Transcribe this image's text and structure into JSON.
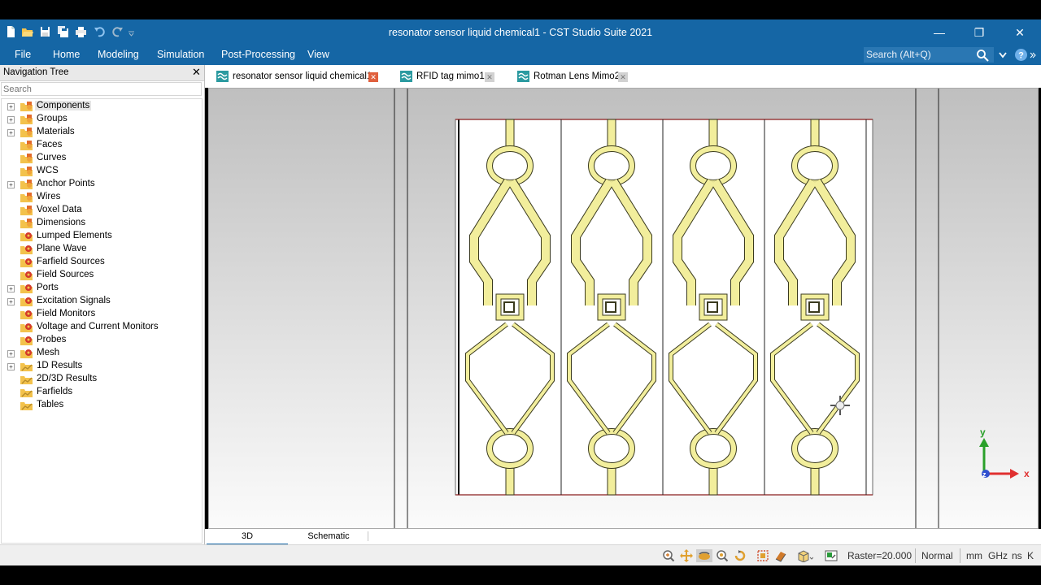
{
  "window": {
    "title": "resonator sensor liquid chemical1 - CST Studio Suite 2021",
    "minimize_glyph": "—",
    "restore_glyph": "❐",
    "close_glyph": "✕"
  },
  "quick_access": [
    "new-file-icon",
    "open-folder-icon",
    "save-icon",
    "save-all-icon",
    "print-icon",
    "undo-icon",
    "redo-icon",
    "customize-icon"
  ],
  "menu": {
    "items": [
      "File",
      "Home",
      "Modeling",
      "Simulation",
      "Post-Processing",
      "View"
    ],
    "search_placeholder": "Search (Alt+Q)"
  },
  "nav": {
    "title": "Navigation Tree",
    "close_glyph": "✕",
    "search_placeholder": "Search",
    "items": [
      {
        "label": "Components",
        "expandable": true,
        "icon": "folder-shapes-icon"
      },
      {
        "label": "Groups",
        "expandable": true,
        "icon": "folder-shapes-icon"
      },
      {
        "label": "Materials",
        "expandable": true,
        "icon": "folder-shapes-icon"
      },
      {
        "label": "Faces",
        "expandable": false,
        "icon": "folder-shapes-icon"
      },
      {
        "label": "Curves",
        "expandable": false,
        "icon": "folder-shapes-icon"
      },
      {
        "label": "WCS",
        "expandable": false,
        "icon": "folder-shapes-icon"
      },
      {
        "label": "Anchor Points",
        "expandable": true,
        "icon": "folder-shapes-icon"
      },
      {
        "label": "Wires",
        "expandable": false,
        "icon": "folder-shapes-icon"
      },
      {
        "label": "Voxel Data",
        "expandable": false,
        "icon": "folder-shapes-icon"
      },
      {
        "label": "Dimensions",
        "expandable": false,
        "icon": "folder-shapes-icon"
      },
      {
        "label": "Lumped Elements",
        "expandable": false,
        "icon": "folder-gear-icon"
      },
      {
        "label": "Plane Wave",
        "expandable": false,
        "icon": "folder-gear-icon"
      },
      {
        "label": "Farfield Sources",
        "expandable": false,
        "icon": "folder-gear-icon"
      },
      {
        "label": "Field Sources",
        "expandable": false,
        "icon": "folder-gear-icon"
      },
      {
        "label": "Ports",
        "expandable": true,
        "icon": "folder-gear-icon"
      },
      {
        "label": "Excitation Signals",
        "expandable": true,
        "icon": "folder-gear-icon"
      },
      {
        "label": "Field Monitors",
        "expandable": false,
        "icon": "folder-gear-icon"
      },
      {
        "label": "Voltage and Current Monitors",
        "expandable": false,
        "icon": "folder-gear-icon"
      },
      {
        "label": "Probes",
        "expandable": false,
        "icon": "folder-gear-icon"
      },
      {
        "label": "Mesh",
        "expandable": true,
        "icon": "folder-gear-icon"
      },
      {
        "label": "1D Results",
        "expandable": true,
        "icon": "folder-results-icon"
      },
      {
        "label": "2D/3D Results",
        "expandable": false,
        "icon": "folder-results-icon"
      },
      {
        "label": "Farfields",
        "expandable": false,
        "icon": "folder-results-icon"
      },
      {
        "label": "Tables",
        "expandable": false,
        "icon": "folder-results-icon"
      }
    ]
  },
  "tabs": [
    {
      "label": "resonator sensor liquid chemical1",
      "active": true
    },
    {
      "label": "RFID tag mimo1",
      "active": false
    },
    {
      "label": "Rotman Lens Mimo2",
      "active": false
    }
  ],
  "tab_close_glyph": "✕",
  "bottom_tabs": [
    {
      "label": "3D",
      "active": true
    },
    {
      "label": "Schematic",
      "active": false
    }
  ],
  "axes": {
    "y": "y",
    "x": "x",
    "z": "z"
  },
  "statusbar": {
    "raster": "Raster=20.000",
    "mode": "Normal",
    "units": [
      "mm",
      "GHz",
      "ns",
      "K"
    ]
  },
  "colors": {
    "title_bar": "#1566a5",
    "trace_fill": "#f2ee9c",
    "trace_stroke": "#3a3a1e",
    "tab_close": "#e0603d",
    "axis_x": "#e03030",
    "axis_y": "#2aa02a",
    "axis_z": "#3050d0"
  }
}
